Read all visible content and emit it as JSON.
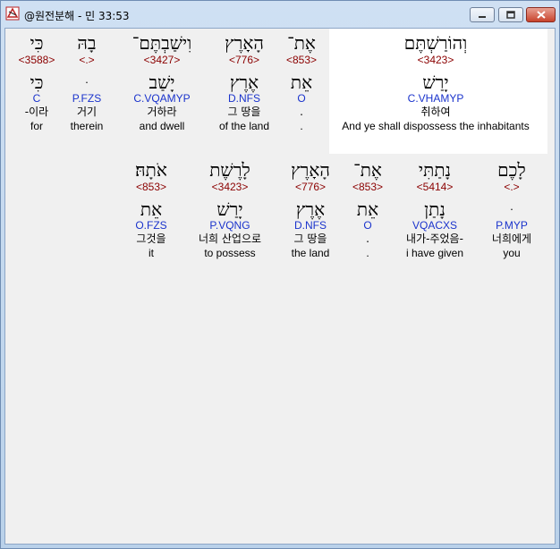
{
  "window": {
    "title": "@원전분해 - 민 33:53",
    "icon": "bible-app-icon",
    "buttons": [
      "minimize",
      "maximize",
      "close"
    ]
  },
  "colors": {
    "strong": "#8b0000",
    "parse": "#1a33cc",
    "highlight_bg": "#ffffff",
    "client_bg": "#f0f0f0"
  },
  "rows": [
    {
      "words": [
        {
          "heb": "וְהוֹרַשְׁתֶּם",
          "strong": "<3423>",
          "lemma": "יָרַשׁ",
          "parse": "C.VHAMYP",
          "kor": "취하여",
          "eng": "And ye shall dispossess the inhabitants",
          "selected": true
        },
        {
          "heb": "אֶת־",
          "strong": "<853>",
          "lemma": "אֵת",
          "parse": "O",
          "kor": ".",
          "eng": "."
        },
        {
          "heb": "הָאָרֶץ",
          "strong": "<776>",
          "lemma": "אֶרֶץ",
          "parse": "D.NFS",
          "kor": "그 땅을",
          "eng": "of the land"
        },
        {
          "heb": "וִישַׁבְתֶּם־",
          "strong": "<3427>",
          "lemma": "יָשַׁב",
          "parse": "C.VQAMYP",
          "kor": "거하라",
          "eng": "and dwell"
        },
        {
          "heb": "בָהּ",
          "strong": "<.>",
          "lemma": "ּ",
          "parse": "P.FZS",
          "kor": "거기",
          "eng": "therein"
        },
        {
          "heb": "כִּי",
          "strong": "<3588>",
          "lemma": "כִּי",
          "parse": "C",
          "kor": "-이라",
          "eng": "for"
        }
      ]
    },
    {
      "words": [
        {
          "heb": "לָכֶם",
          "strong": "<.>",
          "lemma": "ּ",
          "parse": "P.MYP",
          "kor": "너희에게",
          "eng": "you"
        },
        {
          "heb": "נָתַתִּי",
          "strong": "<5414>",
          "lemma": "נָתַן",
          "parse": "VQACXS",
          "kor": "내가-주었음-",
          "eng": "i have given"
        },
        {
          "heb": "אֶת־",
          "strong": "<853>",
          "lemma": "אֵת",
          "parse": "O",
          "kor": ".",
          "eng": "."
        },
        {
          "heb": "הָאָרֶץ",
          "strong": "<776>",
          "lemma": "אֶרֶץ",
          "parse": "D.NFS",
          "kor": "그 땅을",
          "eng": "the land"
        },
        {
          "heb": "לָרֶשֶׁת",
          "strong": "<3423>",
          "lemma": "יָרַשׁ",
          "parse": "P.VQNG",
          "kor": "너희 산업으로",
          "eng": "to possess"
        },
        {
          "heb": "אֹתָהּ׃",
          "strong": "<853>",
          "lemma": "אֵת",
          "parse": "O.FZS",
          "kor": "그것을",
          "eng": "it"
        }
      ]
    }
  ]
}
